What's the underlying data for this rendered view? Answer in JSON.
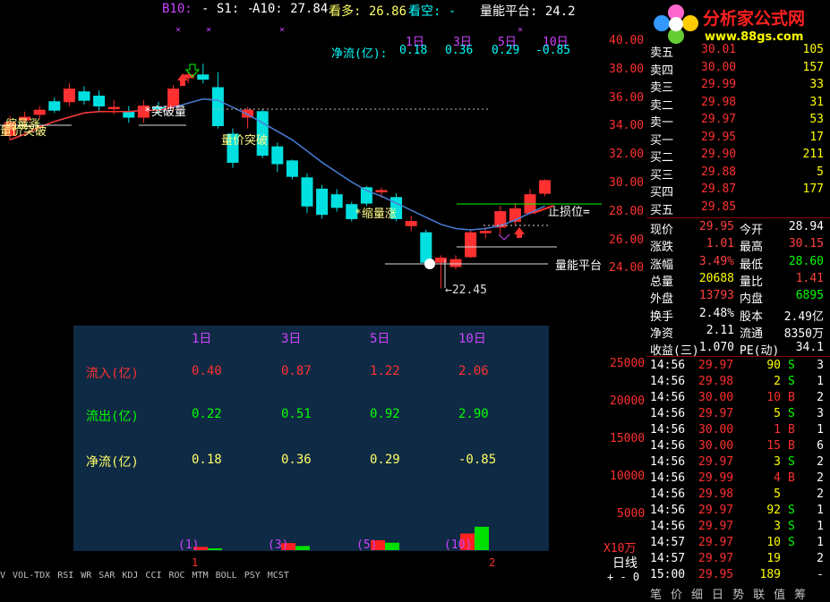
{
  "header": {
    "b10": "B10:",
    "s1": "- S1: -",
    "a10": "A10: 27.84",
    "kanduo": "看多: 26.86",
    "kankong": "看空: -",
    "platform": "量能平台: 24.2"
  },
  "flow_header": {
    "label": "净流(亿):",
    "periods": [
      "1日",
      "3日",
      "5日",
      "10日"
    ],
    "values": [
      "0.18",
      "0.36",
      "0.29",
      "-0.85"
    ]
  },
  "price_axis": [
    "40.00",
    "38.00",
    "36.00",
    "34.00",
    "32.00",
    "30.00",
    "28.00",
    "26.00",
    "24.00"
  ],
  "volume_axis": [
    "25000",
    "20000",
    "15000",
    "10000",
    "5000"
  ],
  "volume_unit": "X10万",
  "period_label": "日线",
  "zoom_ctrl": "+ - 0",
  "annotations": {
    "vol_breakout_left": "量价突破",
    "shrink_left": "缩量涨",
    "breakout_vol": "*突破量",
    "vol_price_breakout": "量价突破",
    "shrink_up": "*缩量涨",
    "stop_loss": "止损位=",
    "platform_label": "量能平台",
    "low_price": "←22.45",
    "marker_x": "×"
  },
  "flow_panel": {
    "periods": [
      "1日",
      "3日",
      "5日",
      "10日"
    ],
    "rows": [
      {
        "label": "流入(亿)",
        "values": [
          "0.40",
          "0.87",
          "1.22",
          "2.06"
        ]
      },
      {
        "label": "流出(亿)",
        "values": [
          "0.22",
          "0.51",
          "0.92",
          "2.90"
        ]
      },
      {
        "label": "净流(亿)",
        "values": [
          "0.18",
          "0.36",
          "0.29",
          "-0.85"
        ]
      }
    ],
    "bar_labels": [
      "(1)",
      "(3)",
      "(5)",
      "(10)"
    ]
  },
  "bottom_markers": [
    "1",
    "2"
  ],
  "indicator_tabs": [
    "V",
    "VOL-TDX",
    "RSI",
    "WR",
    "SAR",
    "KDJ",
    "CCI",
    "ROC",
    "MTM",
    "BOLL",
    "PSY",
    "MCST"
  ],
  "logo": {
    "title": "分析家公式网",
    "url": "www.88gs.com"
  },
  "order_book": [
    {
      "label": "卖五",
      "price": "30.01",
      "vol": "105"
    },
    {
      "label": "卖四",
      "price": "30.00",
      "vol": "157"
    },
    {
      "label": "卖三",
      "price": "29.99",
      "vol": "33"
    },
    {
      "label": "卖二",
      "price": "29.98",
      "vol": "31"
    },
    {
      "label": "卖一",
      "price": "29.97",
      "vol": "53"
    },
    {
      "label": "买一",
      "price": "29.95",
      "vol": "17"
    },
    {
      "label": "买二",
      "price": "29.90",
      "vol": "211"
    },
    {
      "label": "买三",
      "price": "29.88",
      "vol": "5"
    },
    {
      "label": "买四",
      "price": "29.87",
      "vol": "177"
    },
    {
      "label": "买五",
      "price": "29.85",
      "vol": ""
    }
  ],
  "quote": [
    {
      "l1": "现价",
      "v1": "29.95",
      "l2": "今开",
      "v2": "28.94",
      "c1": "#ff4040",
      "c2": "#ffffff"
    },
    {
      "l1": "涨跌",
      "v1": "1.01",
      "l2": "最高",
      "v2": "30.15",
      "c1": "#ff4040",
      "c2": "#ff4040"
    },
    {
      "l1": "涨幅",
      "v1": "3.49%",
      "l2": "最低",
      "v2": "28.60",
      "c1": "#ff4040",
      "c2": "#00ff00"
    },
    {
      "l1": "总量",
      "v1": "20688",
      "l2": "量比",
      "v2": "1.41",
      "c1": "#ffff00",
      "c2": "#ff4040"
    },
    {
      "l1": "外盘",
      "v1": "13793",
      "l2": "内盘",
      "v2": "6895",
      "c1": "#ff4040",
      "c2": "#00ff00"
    },
    {
      "l1": "换手",
      "v1": "2.48%",
      "l2": "股本",
      "v2": "2.49亿",
      "c1": "#ffffff",
      "c2": "#ffffff"
    },
    {
      "l1": "净资",
      "v1": "2.11",
      "l2": "流通",
      "v2": "8350万",
      "c1": "#ffffff",
      "c2": "#ffffff"
    },
    {
      "l1": "收益(三)",
      "v1": "1.070",
      "l2": "PE(动)",
      "v2": "34.1",
      "c1": "#ffffff",
      "c2": "#ffffff"
    }
  ],
  "ticks": [
    {
      "t": "14:56",
      "p": "29.97",
      "v": "90",
      "s": "S",
      "n": "3"
    },
    {
      "t": "14:56",
      "p": "29.98",
      "v": "2",
      "s": "S",
      "n": "1"
    },
    {
      "t": "14:56",
      "p": "30.00",
      "v": "10",
      "s": "B",
      "n": "2"
    },
    {
      "t": "14:56",
      "p": "29.97",
      "v": "5",
      "s": "S",
      "n": "3"
    },
    {
      "t": "14:56",
      "p": "30.00",
      "v": "1",
      "s": "B",
      "n": "1"
    },
    {
      "t": "14:56",
      "p": "30.00",
      "v": "15",
      "s": "B",
      "n": "6"
    },
    {
      "t": "14:56",
      "p": "29.97",
      "v": "3",
      "s": "S",
      "n": "2"
    },
    {
      "t": "14:56",
      "p": "29.99",
      "v": "4",
      "s": "B",
      "n": "2"
    },
    {
      "t": "14:56",
      "p": "29.98",
      "v": "5",
      "s": "",
      "n": "2"
    },
    {
      "t": "14:56",
      "p": "29.97",
      "v": "92",
      "s": "S",
      "n": "1"
    },
    {
      "t": "14:56",
      "p": "29.97",
      "v": "3",
      "s": "S",
      "n": "1"
    },
    {
      "t": "14:57",
      "p": "29.97",
      "v": "10",
      "s": "S",
      "n": "1"
    },
    {
      "t": "14:57",
      "p": "29.97",
      "v": "19",
      "s": "",
      "n": "2"
    },
    {
      "t": "15:00",
      "p": "29.95",
      "v": "189",
      "s": "",
      "n": "-"
    }
  ],
  "right_tabs": [
    "笔",
    "价",
    "细",
    "日",
    "势",
    "联",
    "值",
    "筹"
  ],
  "colors": {
    "up": "#ff3030",
    "down": "#00e0e0",
    "ma": "#4a7fd8",
    "panel": "#0f2a44",
    "label_purple": "#cc44ff"
  },
  "chart_data": {
    "type": "candlestick",
    "y_range": [
      22,
      41
    ],
    "candles": [
      {
        "o": 33.3,
        "c": 34.2,
        "h": 34.7,
        "l": 33.0
      },
      {
        "o": 34.4,
        "c": 34.6,
        "h": 35.0,
        "l": 34.0
      },
      {
        "o": 34.8,
        "c": 35.1,
        "h": 35.4,
        "l": 34.5
      },
      {
        "o": 35.7,
        "c": 35.1,
        "h": 36.0,
        "l": 34.9
      },
      {
        "o": 35.7,
        "c": 36.6,
        "h": 37.0,
        "l": 35.4
      },
      {
        "o": 36.4,
        "c": 35.8,
        "h": 36.8,
        "l": 35.5
      },
      {
        "o": 36.1,
        "c": 35.4,
        "h": 36.5,
        "l": 35.0
      },
      {
        "o": 35.2,
        "c": 35.3,
        "h": 35.8,
        "l": 34.8
      },
      {
        "o": 35.0,
        "c": 34.6,
        "h": 35.4,
        "l": 34.2
      },
      {
        "o": 34.6,
        "c": 35.4,
        "h": 35.8,
        "l": 34.2
      },
      {
        "o": 35.3,
        "c": 35.1,
        "h": 35.7,
        "l": 34.8
      },
      {
        "o": 35.3,
        "c": 36.6,
        "h": 36.9,
        "l": 35.0
      },
      {
        "o": 37.4,
        "c": 37.6,
        "h": 37.8,
        "l": 37.0
      },
      {
        "o": 37.6,
        "c": 37.3,
        "h": 38.4,
        "l": 37.0
      },
      {
        "o": 36.7,
        "c": 34.0,
        "h": 37.8,
        "l": 33.8
      },
      {
        "o": 33.4,
        "c": 31.4,
        "h": 33.8,
        "l": 31.0
      },
      {
        "o": 34.6,
        "c": 35.1,
        "h": 35.3,
        "l": 33.8
      },
      {
        "o": 35.0,
        "c": 31.9,
        "h": 35.2,
        "l": 31.7
      },
      {
        "o": 32.5,
        "c": 31.3,
        "h": 32.8,
        "l": 30.7
      },
      {
        "o": 31.5,
        "c": 30.4,
        "h": 31.6,
        "l": 30.2
      },
      {
        "o": 30.3,
        "c": 28.3,
        "h": 30.6,
        "l": 27.8
      },
      {
        "o": 29.5,
        "c": 27.7,
        "h": 29.8,
        "l": 27.4
      },
      {
        "o": 29.1,
        "c": 28.2,
        "h": 29.5,
        "l": 27.9
      },
      {
        "o": 28.4,
        "c": 27.4,
        "h": 28.6,
        "l": 27.2
      },
      {
        "o": 29.6,
        "c": 28.5,
        "h": 29.7,
        "l": 28.3
      },
      {
        "o": 29.3,
        "c": 29.4,
        "h": 29.6,
        "l": 28.9
      },
      {
        "o": 28.9,
        "c": 27.4,
        "h": 29.2,
        "l": 27.2
      },
      {
        "o": 26.9,
        "c": 27.2,
        "h": 27.6,
        "l": 26.5
      },
      {
        "o": 26.4,
        "c": 24.3,
        "h": 26.6,
        "l": 23.9
      },
      {
        "o": 24.3,
        "c": 24.6,
        "h": 24.8,
        "l": 22.45
      },
      {
        "o": 24.0,
        "c": 24.5,
        "h": 24.8,
        "l": 23.8
      },
      {
        "o": 24.7,
        "c": 26.4,
        "h": 26.6,
        "l": 24.6
      },
      {
        "o": 26.4,
        "c": 26.5,
        "h": 26.8,
        "l": 26.0
      },
      {
        "o": 26.8,
        "c": 27.9,
        "h": 28.3,
        "l": 26.3
      },
      {
        "o": 27.2,
        "c": 28.1,
        "h": 28.5,
        "l": 26.9
      },
      {
        "o": 27.8,
        "c": 29.1,
        "h": 29.5,
        "l": 27.7
      },
      {
        "o": 29.2,
        "c": 30.1,
        "h": 30.2,
        "l": 29.0
      }
    ],
    "ma": [
      33.0,
      33.4,
      33.9,
      34.3,
      34.6,
      34.9,
      35.0,
      35.0,
      35.0,
      35.1,
      35.1,
      35.3,
      35.6,
      35.9,
      35.8,
      35.3,
      34.8,
      34.2,
      33.6,
      33.0,
      32.2,
      31.4,
      30.7,
      30.0,
      29.4,
      29.0,
      28.5,
      28.0,
      27.5,
      27.0,
      26.7,
      26.6,
      26.7,
      26.9,
      27.3,
      27.8,
      28.3
    ],
    "flow_bars": [
      {
        "in": 0.4,
        "out": 0.22
      },
      {
        "in": 0.87,
        "out": 0.51
      },
      {
        "in": 1.22,
        "out": 0.92
      },
      {
        "in": 2.06,
        "out": 2.9
      }
    ]
  }
}
